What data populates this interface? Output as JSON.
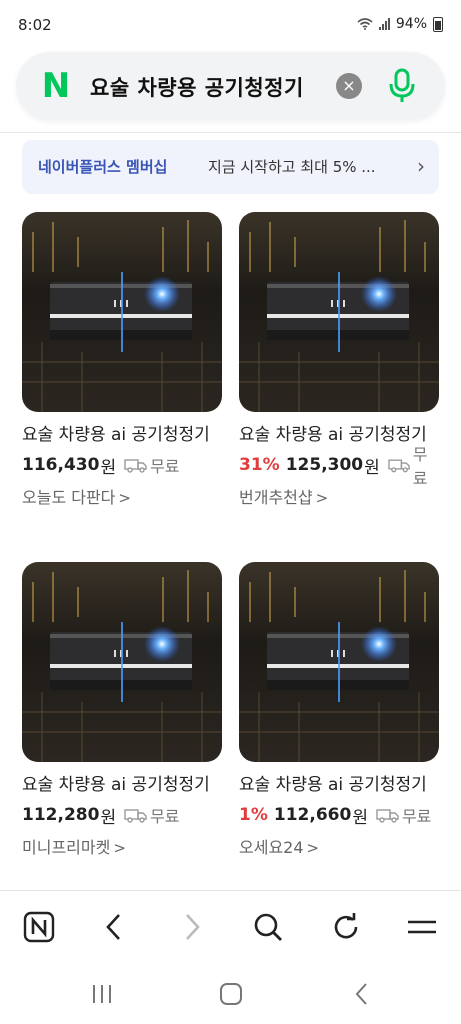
{
  "status": {
    "time": "8:02",
    "battery": "94%"
  },
  "search": {
    "query": "요술 차량용 공기청정기",
    "logo": "N"
  },
  "membership": {
    "name": "네이버플러스 멤버십",
    "desc": "지금 시작하고 최대 5% ...",
    "chevron": "›"
  },
  "products": [
    {
      "title": "요술 차량용 ai 공기청정기",
      "discount": "",
      "price": "116,430",
      "won": "원",
      "shipping": "무료",
      "store": "오늘도 다판다"
    },
    {
      "title": "요술 차량용 ai 공기청정기",
      "discount": "31%",
      "price": "125,300",
      "won": "원",
      "shipping": "무료",
      "store": "번개추천샵"
    },
    {
      "title": "요술 차량용 ai 공기청정기",
      "discount": "",
      "price": "112,280",
      "won": "원",
      "shipping": "무료",
      "store": "미니프리마켓"
    },
    {
      "title": "요술 차량용 ai 공기청정기",
      "discount": "1%",
      "price": "112,660",
      "won": "원",
      "shipping": "무료",
      "store": "오세요24"
    }
  ],
  "colors": {
    "naver_green": "#03c75a",
    "discount_red": "#e03e3e",
    "membership_blue": "#3a55b5"
  },
  "icons": {
    "status": [
      "wifi-icon",
      "signal-icon",
      "battery-icon"
    ],
    "search": [
      "naver-logo",
      "clear-icon",
      "mic-icon"
    ],
    "nav": [
      "naver-home-icon",
      "back-icon",
      "forward-icon",
      "search-icon",
      "refresh-icon",
      "menu-icon"
    ],
    "system": [
      "recent-apps-icon",
      "home-icon",
      "back-icon"
    ]
  }
}
